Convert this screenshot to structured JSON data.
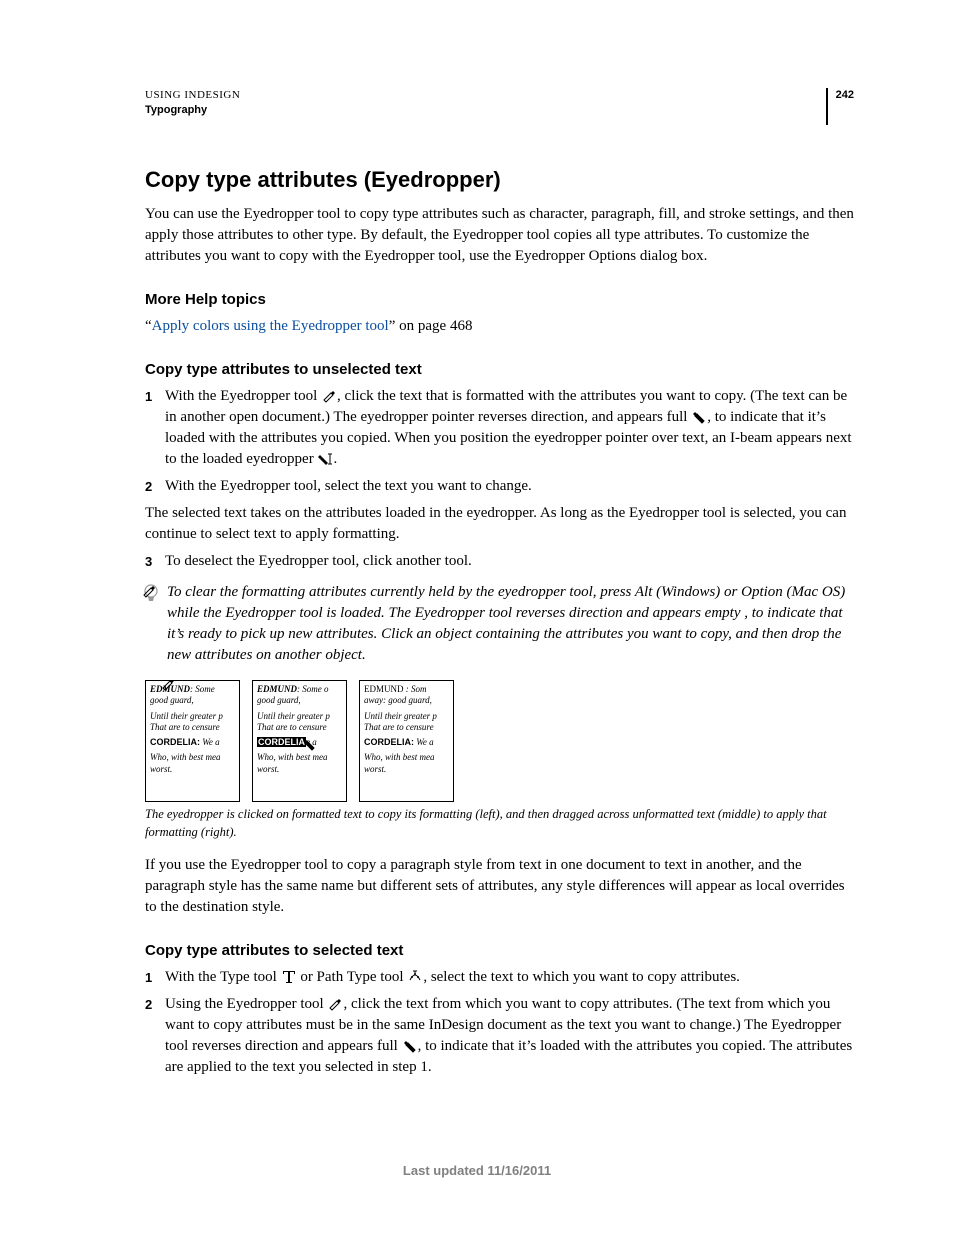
{
  "header": {
    "breadcrumb": "USING INDESIGN",
    "section": "Typography",
    "page_number": "242"
  },
  "title": "Copy type attributes (Eyedropper)",
  "intro": "You can use the Eyedropper tool to copy type attributes such as character, paragraph, fill, and stroke settings, and then apply those attributes to other type. By default, the Eyedropper tool copies all type attributes. To customize the attributes you want to copy with the Eyedropper tool, use the Eyedropper Options dialog box.",
  "more_help": {
    "heading": "More Help topics",
    "quote_open": "“",
    "link_text": "Apply colors using the Eyedropper tool",
    "quote_close_suffix": "” on page 468"
  },
  "section_a": {
    "heading": "Copy type attributes to unselected text",
    "step1_a": "With the Eyedropper tool ",
    "step1_b": ", click the text that is formatted with the attributes you want to copy. (The text can be in another open document.) The eyedropper pointer reverses direction, and appears full ",
    "step1_c": ", to indicate that it’s loaded with the attributes you copied. When you position the eyedropper pointer over text, an I-beam appears next to the loaded eyedropper ",
    "step1_d": ".",
    "step2": "With the Eyedropper tool, select the text you want to change.",
    "para_after": "The selected text takes on the attributes loaded in the eyedropper. As long as the Eyedropper tool is selected, you can continue to select text to apply formatting.",
    "step3": "To deselect the Eyedropper tool, click another tool."
  },
  "tip": {
    "a": "To clear the formatting attributes currently held by the eyedropper tool, press Alt (Windows) or Option (Mac OS) while the Eyedropper tool is loaded. The Eyedropper tool reverses direction and appears empty ",
    "b": ", to indicate that it’s ready to pick up new attributes. Click an object containing the attributes you want to copy, and then drop the new attributes on another object."
  },
  "figure": {
    "panel": {
      "l1a": "EDMUND",
      "l1b": ": Some",
      "l1b_mid": ": Some o",
      "l1b_right": " : Som",
      "l2": "good guard,",
      "l2_right": "away: good guard,",
      "l3": "Until their greater p",
      "l4": "That are to censure",
      "l5a": "CORDELIA:",
      "l5b": " We a",
      "l5_mid_hl": "CORDELIA",
      "l5_mid_b": "e a",
      "l6": "Who, with best mea",
      "l7": "worst."
    },
    "caption": "The eyedropper is clicked on formatted text to copy its formatting (left), and then dragged across unformatted text (middle) to apply that formatting (right)."
  },
  "para_after_fig": "If you use the Eyedropper tool to copy a paragraph style from text in one document to text in another, and the paragraph style has the same name but different sets of attributes, any style differences will appear as local overrides to the destination style.",
  "section_b": {
    "heading": "Copy type attributes to selected text",
    "step1_a": "With the Type tool ",
    "step1_b": " or Path Type tool ",
    "step1_c": ", select the text to which you want to copy attributes.",
    "step2_a": "Using the Eyedropper tool ",
    "step2_b": ", click the text from which you want to copy attributes. (The text from which you want to copy attributes must be in the same InDesign document as the text you want to change.) The Eyedropper tool reverses direction and appears full ",
    "step2_c": ", to indicate that it’s loaded with the attributes you copied. The attributes are applied to the text you selected in step 1."
  },
  "footer": "Last updated 11/16/2011"
}
